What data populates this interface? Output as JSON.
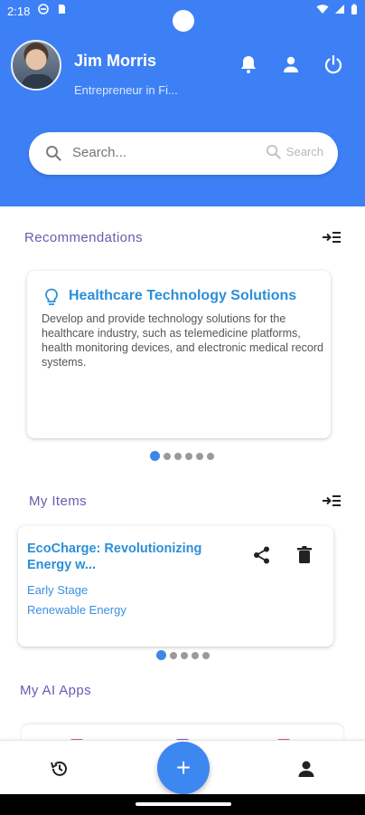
{
  "statusbar": {
    "time": "2:18"
  },
  "header": {
    "user_name": "Jim Morris",
    "user_subtitle": "Entrepreneur in Fi...",
    "icons": [
      "bell-icon",
      "person-icon",
      "power-icon"
    ]
  },
  "search": {
    "placeholder": "Search...",
    "button_label": "Search"
  },
  "recommendations": {
    "title": "Recommendations",
    "card": {
      "title": "Healthcare Technology Solutions",
      "description": "Develop and provide technology solutions for the healthcare industry, such as telemedicine platforms, health monitoring devices, and electronic medical record systems."
    },
    "page_count": 6,
    "active_page": 0
  },
  "my_items": {
    "title": "My Items",
    "card": {
      "title": "EcoCharge: Revolutionizing Energy w...",
      "stage": "Early Stage",
      "category": "Renewable Energy"
    },
    "page_count": 5,
    "active_page": 0
  },
  "my_ai_apps": {
    "title": "My AI Apps"
  },
  "bottom_nav": {
    "fab_label": "+",
    "icons": [
      "history-icon",
      "add-icon",
      "profile-icon"
    ]
  },
  "colors": {
    "header_blue": "#3d80f5",
    "accent_blue": "#2a8fd8",
    "section_purple": "#6b5bb0"
  }
}
